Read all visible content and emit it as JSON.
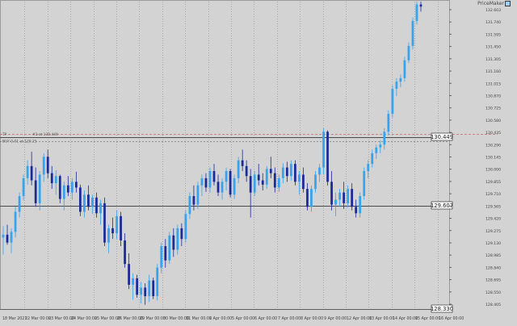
{
  "app": {
    "badge_text": "PriceMaker",
    "colors": {
      "background": "#d3d3d3",
      "grid": "#a8a8a8",
      "bull": "#36a3ee",
      "bear": "#1a2a9a",
      "hline": "#4a4a4a",
      "dash_line": "#c96b6b",
      "label_bg": "#ffffff",
      "text": "#404040"
    }
  },
  "chart_data": {
    "type": "candlestick",
    "symbol_note": "GBPJPY-style H4",
    "y_ticks": [
      "132.603",
      "131.740",
      "131.595",
      "131.450",
      "131.305",
      "131.160",
      "131.015",
      "130.870",
      "130.725",
      "130.580",
      "130.435",
      "130.290",
      "130.145",
      "130.000",
      "129.855",
      "129.710",
      "129.565",
      "129.420",
      "129.275",
      "129.130",
      "128.985",
      "128.840",
      "128.695",
      "128.550",
      "128.405"
    ],
    "x_ticks": [
      "18 Mar 2021",
      "22 Mar 00:00",
      "23 Mar 00:00",
      "24 Mar 00:00",
      "25 Mar 00:00",
      "26 Mar 00:00",
      "29 Mar 00:00",
      "30 Mar 00:00",
      "31 Mar 00:00",
      "1 Apr 00:00",
      "5 Apr 00:00",
      "6 Apr 00:00",
      "7 Apr 00:00",
      "8 Apr 00:00",
      "9 Apr 00:00",
      "12 Apr 00:00",
      "13 Apr 00:00",
      "14 Apr 00:00",
      "15 Apr 00:00",
      "16 Apr 00:00"
    ],
    "price_labels": [
      {
        "value": "130.449"
      },
      {
        "value": "129.607"
      },
      {
        "value": "128.330"
      }
    ],
    "annotations": {
      "top_left_marker": "TP",
      "order_label": "BUY 0.01 at 129.25",
      "entry_label": "#3 at 130.449"
    },
    "candles": [
      {
        "o": 129.32,
        "h": 129.48,
        "l": 129.08,
        "c": 129.36
      },
      {
        "o": 129.36,
        "h": 129.5,
        "l": 129.22,
        "c": 129.25
      },
      {
        "o": 129.25,
        "h": 129.45,
        "l": 129.1,
        "c": 129.4
      },
      {
        "o": 129.4,
        "h": 129.75,
        "l": 129.32,
        "c": 129.68
      },
      {
        "o": 129.68,
        "h": 129.95,
        "l": 129.6,
        "c": 129.9
      },
      {
        "o": 129.9,
        "h": 130.2,
        "l": 129.84,
        "c": 130.15
      },
      {
        "o": 130.15,
        "h": 130.4,
        "l": 130.06,
        "c": 130.32
      },
      {
        "o": 130.32,
        "h": 130.52,
        "l": 130.05,
        "c": 130.12
      },
      {
        "o": 130.12,
        "h": 130.3,
        "l": 129.75,
        "c": 129.8
      },
      {
        "o": 129.8,
        "h": 130.25,
        "l": 129.7,
        "c": 130.2
      },
      {
        "o": 130.2,
        "h": 130.5,
        "l": 130.1,
        "c": 130.45
      },
      {
        "o": 130.45,
        "h": 130.55,
        "l": 130.15,
        "c": 130.22
      },
      {
        "o": 130.22,
        "h": 130.32,
        "l": 130.0,
        "c": 130.08
      },
      {
        "o": 130.08,
        "h": 130.26,
        "l": 129.92,
        "c": 130.18
      },
      {
        "o": 130.18,
        "h": 130.2,
        "l": 129.8,
        "c": 129.86
      },
      {
        "o": 129.86,
        "h": 130.1,
        "l": 129.7,
        "c": 130.05
      },
      {
        "o": 130.05,
        "h": 130.18,
        "l": 129.9,
        "c": 129.95
      },
      {
        "o": 129.95,
        "h": 130.15,
        "l": 129.85,
        "c": 130.1
      },
      {
        "o": 130.1,
        "h": 130.24,
        "l": 129.95,
        "c": 130.02
      },
      {
        "o": 130.02,
        "h": 130.06,
        "l": 129.62,
        "c": 129.68
      },
      {
        "o": 129.68,
        "h": 129.98,
        "l": 129.6,
        "c": 129.92
      },
      {
        "o": 129.92,
        "h": 130.05,
        "l": 129.7,
        "c": 129.75
      },
      {
        "o": 129.75,
        "h": 129.92,
        "l": 129.65,
        "c": 129.88
      },
      {
        "o": 129.88,
        "h": 129.95,
        "l": 129.6,
        "c": 129.66
      },
      {
        "o": 129.66,
        "h": 129.85,
        "l": 129.5,
        "c": 129.8
      },
      {
        "o": 129.8,
        "h": 129.88,
        "l": 129.2,
        "c": 129.25
      },
      {
        "o": 129.25,
        "h": 129.5,
        "l": 129.1,
        "c": 129.45
      },
      {
        "o": 129.45,
        "h": 129.6,
        "l": 129.3,
        "c": 129.38
      },
      {
        "o": 129.38,
        "h": 129.7,
        "l": 129.3,
        "c": 129.62
      },
      {
        "o": 129.62,
        "h": 129.68,
        "l": 129.2,
        "c": 129.28
      },
      {
        "o": 129.28,
        "h": 129.38,
        "l": 128.9,
        "c": 128.95
      },
      {
        "o": 128.95,
        "h": 129.1,
        "l": 128.6,
        "c": 128.66
      },
      {
        "o": 128.66,
        "h": 128.82,
        "l": 128.45,
        "c": 128.75
      },
      {
        "o": 128.75,
        "h": 128.8,
        "l": 128.48,
        "c": 128.52
      },
      {
        "o": 128.52,
        "h": 128.7,
        "l": 128.4,
        "c": 128.62
      },
      {
        "o": 128.62,
        "h": 128.68,
        "l": 128.38,
        "c": 128.5
      },
      {
        "o": 128.5,
        "h": 128.8,
        "l": 128.42,
        "c": 128.72
      },
      {
        "o": 128.72,
        "h": 128.76,
        "l": 128.46,
        "c": 128.5
      },
      {
        "o": 128.5,
        "h": 128.95,
        "l": 128.44,
        "c": 128.9
      },
      {
        "o": 128.9,
        "h": 129.25,
        "l": 128.82,
        "c": 129.2
      },
      {
        "o": 129.2,
        "h": 129.3,
        "l": 128.9,
        "c": 129.0
      },
      {
        "o": 129.0,
        "h": 129.4,
        "l": 128.95,
        "c": 129.35
      },
      {
        "o": 129.35,
        "h": 129.45,
        "l": 129.05,
        "c": 129.15
      },
      {
        "o": 129.15,
        "h": 129.5,
        "l": 129.08,
        "c": 129.45
      },
      {
        "o": 129.45,
        "h": 129.52,
        "l": 129.2,
        "c": 129.3
      },
      {
        "o": 129.3,
        "h": 129.7,
        "l": 129.25,
        "c": 129.65
      },
      {
        "o": 129.65,
        "h": 129.95,
        "l": 129.58,
        "c": 129.9
      },
      {
        "o": 129.9,
        "h": 130.05,
        "l": 129.7,
        "c": 129.78
      },
      {
        "o": 129.78,
        "h": 130.1,
        "l": 129.72,
        "c": 130.05
      },
      {
        "o": 130.05,
        "h": 130.2,
        "l": 129.9,
        "c": 130.15
      },
      {
        "o": 130.15,
        "h": 130.22,
        "l": 129.96,
        "c": 130.02
      },
      {
        "o": 130.02,
        "h": 130.3,
        "l": 129.95,
        "c": 130.25
      },
      {
        "o": 130.25,
        "h": 130.35,
        "l": 130.05,
        "c": 130.1
      },
      {
        "o": 130.1,
        "h": 130.2,
        "l": 129.9,
        "c": 129.95
      },
      {
        "o": 129.95,
        "h": 130.15,
        "l": 129.85,
        "c": 130.1
      },
      {
        "o": 130.1,
        "h": 130.3,
        "l": 129.98,
        "c": 130.25
      },
      {
        "o": 130.25,
        "h": 130.28,
        "l": 129.88,
        "c": 129.92
      },
      {
        "o": 129.92,
        "h": 130.2,
        "l": 129.86,
        "c": 130.15
      },
      {
        "o": 130.15,
        "h": 130.45,
        "l": 130.08,
        "c": 130.4
      },
      {
        "o": 130.4,
        "h": 130.55,
        "l": 130.25,
        "c": 130.32
      },
      {
        "o": 130.32,
        "h": 130.4,
        "l": 130.1,
        "c": 130.18
      },
      {
        "o": 130.18,
        "h": 130.28,
        "l": 129.6,
        "c": 129.95
      },
      {
        "o": 129.95,
        "h": 130.25,
        "l": 129.9,
        "c": 130.2
      },
      {
        "o": 130.2,
        "h": 130.35,
        "l": 130.05,
        "c": 130.12
      },
      {
        "o": 130.12,
        "h": 130.22,
        "l": 129.98,
        "c": 130.06
      },
      {
        "o": 130.06,
        "h": 130.32,
        "l": 130.0,
        "c": 130.28
      },
      {
        "o": 130.28,
        "h": 130.45,
        "l": 130.15,
        "c": 130.22
      },
      {
        "o": 130.22,
        "h": 130.3,
        "l": 129.95,
        "c": 130.02
      },
      {
        "o": 130.02,
        "h": 130.2,
        "l": 129.96,
        "c": 130.15
      },
      {
        "o": 130.15,
        "h": 130.36,
        "l": 130.08,
        "c": 130.3
      },
      {
        "o": 130.3,
        "h": 130.38,
        "l": 130.1,
        "c": 130.18
      },
      {
        "o": 130.18,
        "h": 130.4,
        "l": 130.12,
        "c": 130.35
      },
      {
        "o": 130.35,
        "h": 130.4,
        "l": 130.05,
        "c": 130.1
      },
      {
        "o": 130.1,
        "h": 130.25,
        "l": 129.92,
        "c": 130.2
      },
      {
        "o": 130.2,
        "h": 130.3,
        "l": 129.95,
        "c": 130.0
      },
      {
        "o": 130.0,
        "h": 130.08,
        "l": 129.7,
        "c": 129.75
      },
      {
        "o": 129.75,
        "h": 130.05,
        "l": 129.68,
        "c": 130.0
      },
      {
        "o": 130.0,
        "h": 130.25,
        "l": 129.95,
        "c": 130.2
      },
      {
        "o": 130.2,
        "h": 130.35,
        "l": 130.1,
        "c": 130.3
      },
      {
        "o": 130.3,
        "h": 130.85,
        "l": 130.2,
        "c": 130.8
      },
      {
        "o": 130.8,
        "h": 130.82,
        "l": 130.05,
        "c": 130.1
      },
      {
        "o": 130.1,
        "h": 130.25,
        "l": 129.7,
        "c": 129.78
      },
      {
        "o": 129.78,
        "h": 129.95,
        "l": 129.62,
        "c": 129.85
      },
      {
        "o": 129.85,
        "h": 130.0,
        "l": 129.75,
        "c": 129.95
      },
      {
        "o": 129.95,
        "h": 130.1,
        "l": 129.72,
        "c": 129.8
      },
      {
        "o": 129.8,
        "h": 130.05,
        "l": 129.74,
        "c": 130.0
      },
      {
        "o": 130.0,
        "h": 130.08,
        "l": 129.7,
        "c": 129.75
      },
      {
        "o": 129.75,
        "h": 129.85,
        "l": 129.6,
        "c": 129.66
      },
      {
        "o": 129.66,
        "h": 129.95,
        "l": 129.6,
        "c": 129.9
      },
      {
        "o": 129.9,
        "h": 130.3,
        "l": 129.85,
        "c": 130.25
      },
      {
        "o": 130.25,
        "h": 130.4,
        "l": 130.15,
        "c": 130.35
      },
      {
        "o": 130.35,
        "h": 130.55,
        "l": 130.3,
        "c": 130.5
      },
      {
        "o": 130.5,
        "h": 130.62,
        "l": 130.42,
        "c": 130.58
      },
      {
        "o": 130.58,
        "h": 130.68,
        "l": 130.5,
        "c": 130.62
      },
      {
        "o": 130.62,
        "h": 130.85,
        "l": 130.55,
        "c": 130.8
      },
      {
        "o": 130.8,
        "h": 131.1,
        "l": 130.75,
        "c": 131.05
      },
      {
        "o": 131.05,
        "h": 131.45,
        "l": 131.0,
        "c": 131.4
      },
      {
        "o": 131.4,
        "h": 131.55,
        "l": 131.3,
        "c": 131.5
      },
      {
        "o": 131.5,
        "h": 131.6,
        "l": 131.42,
        "c": 131.55
      },
      {
        "o": 131.55,
        "h": 131.85,
        "l": 131.5,
        "c": 131.8
      },
      {
        "o": 131.8,
        "h": 132.05,
        "l": 131.76,
        "c": 132.0
      },
      {
        "o": 132.0,
        "h": 132.4,
        "l": 131.95,
        "c": 132.35
      },
      {
        "o": 132.35,
        "h": 132.62,
        "l": 132.3,
        "c": 132.58
      },
      {
        "o": 132.58,
        "h": 132.62,
        "l": 132.48,
        "c": 132.55
      }
    ],
    "grid": true
  }
}
